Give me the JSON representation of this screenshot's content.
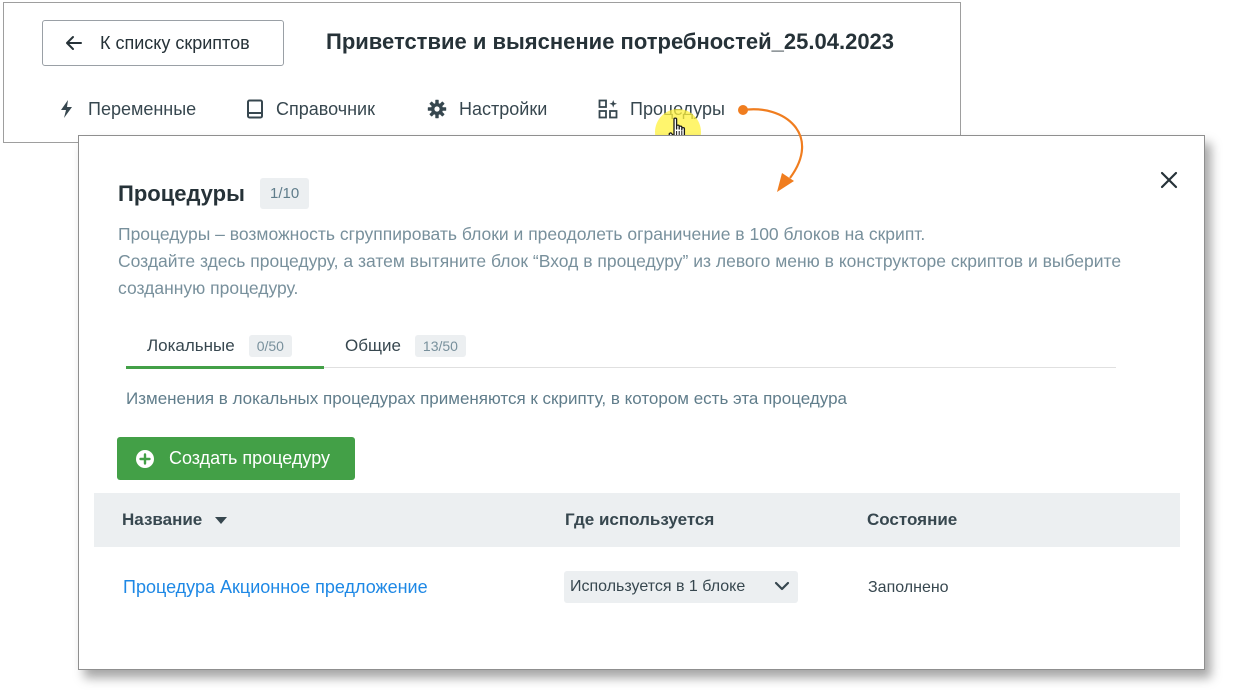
{
  "header": {
    "back_button_label": "К списку скриптов",
    "script_title": "Приветствие и выяснение потребностей_25.04.2023",
    "nav": [
      {
        "label": "Переменные",
        "icon": "lightning-icon"
      },
      {
        "label": "Справочник",
        "icon": "book-icon"
      },
      {
        "label": "Настройки",
        "icon": "gear-icon"
      },
      {
        "label": "Процедуры",
        "icon": "procedures-icon"
      }
    ]
  },
  "modal": {
    "title": "Процедуры",
    "count": "1/10",
    "description": [
      "Процедуры – возможность сгруппировать блоки и преодолеть ограничение в 100 блоков на скрипт.",
      "Создайте здесь процедуру, а затем вытяните блок “Вход в процедуру” из левого меню в конструкторе скриптов и выберите созданную процедуру."
    ],
    "tabs": [
      {
        "label": "Локальные",
        "count": "0/50",
        "active": true
      },
      {
        "label": "Общие",
        "count": "13/50",
        "active": false
      }
    ],
    "hint": "Изменения в локальных процедурах применяются к скрипту, в котором есть эта процедура",
    "create_button_label": "Создать процедуру",
    "table": {
      "columns": [
        "Название",
        "Где используется",
        "Состояние"
      ],
      "rows": [
        {
          "name": "Процедура Акционное предложение",
          "usage": "Используется в 1 блоке",
          "state": "Заполнено"
        }
      ]
    }
  },
  "colors": {
    "accent_green": "#43a047",
    "link_blue": "#1e88e5",
    "annotation_orange": "#f07d1f",
    "cursor_highlight": "#fff13c"
  }
}
